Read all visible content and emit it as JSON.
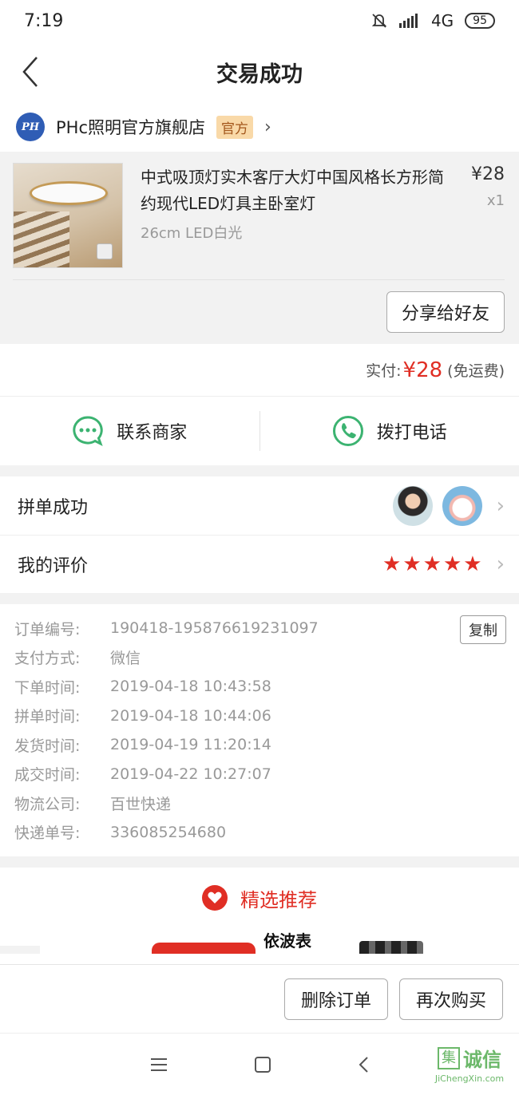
{
  "status_bar": {
    "time": "7:19",
    "network": "4G",
    "battery": "95"
  },
  "nav": {
    "title": "交易成功"
  },
  "shop": {
    "logo_text": "PH",
    "name": "PHc照明官方旗舰店",
    "badge": "官方"
  },
  "product": {
    "title": "中式吸顶灯实木客厅大灯中国风格长方形简约现代LED灯具主卧室灯",
    "spec": "26cm LED白光",
    "price": "¥28",
    "qty": "x1",
    "share_label": "分享给好友"
  },
  "payment": {
    "label": "实付:",
    "amount": "¥28",
    "note": "(免运费)"
  },
  "contact": {
    "merchant_label": "联系商家",
    "call_label": "拨打电话"
  },
  "group": {
    "label": "拼单成功"
  },
  "review": {
    "label": "我的评价",
    "stars": 5
  },
  "order_details": {
    "copy_label": "复制",
    "rows": [
      {
        "label": "订单编号:",
        "value": "190418-195876619231097"
      },
      {
        "label": "支付方式:",
        "value": "微信"
      },
      {
        "label": "下单时间:",
        "value": "2019-04-18 10:43:58"
      },
      {
        "label": "拼单时间:",
        "value": "2019-04-18 10:44:06"
      },
      {
        "label": "发货时间:",
        "value": "2019-04-19 11:20:14"
      },
      {
        "label": "成交时间:",
        "value": "2019-04-22 10:27:07"
      },
      {
        "label": "物流公司:",
        "value": "百世快递"
      },
      {
        "label": "快递单号:",
        "value": "336085254680"
      }
    ]
  },
  "recommend": {
    "title": "精选推荐",
    "brand_text": "依波表"
  },
  "actions": {
    "delete_label": "删除订单",
    "rebuy_label": "再次购买"
  },
  "watermark": {
    "box_char": "集",
    "text": "诚信",
    "url": "JiChengXin.com"
  },
  "colors": {
    "accent": "#e02e24",
    "wechat_green": "#3cb371"
  }
}
